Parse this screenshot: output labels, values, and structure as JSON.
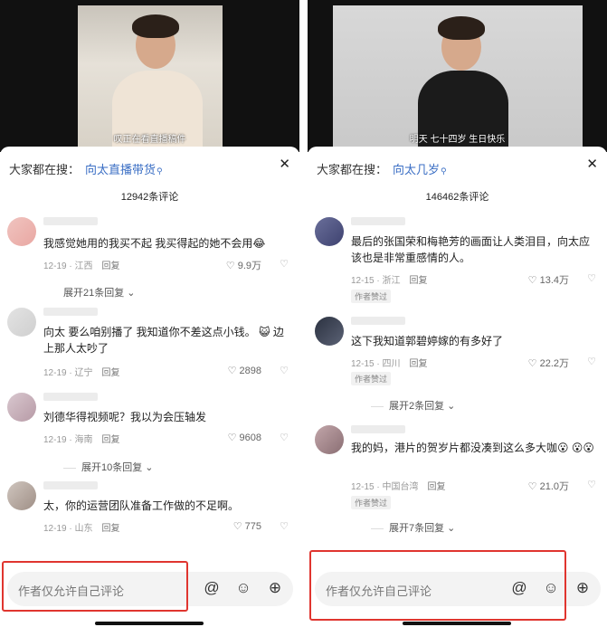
{
  "left": {
    "caption": "叹正在看直播稿件",
    "search_prefix": "大家都在搜：",
    "search_keyword": "向太直播带货",
    "comment_count": "12942条评论",
    "comments": [
      {
        "text": "我感觉她用的我买不起 我买得起的她不会用😂",
        "date": "12-19",
        "location": "江西",
        "reply": "回复",
        "likes": "9.9万",
        "expand": "展开21条回复"
      },
      {
        "text": "向太 要么咱别播了 我知道你不差这点小钱。 😺 边上那人太吵了",
        "date": "12-19",
        "location": "辽宁",
        "reply": "回复",
        "likes": "2898",
        "expand": ""
      },
      {
        "text": "刘德华得视频呢？我以为会压轴发",
        "date": "12-19",
        "location": "海南",
        "reply": "回复",
        "likes": "9608",
        "expand": "展开10条回复"
      },
      {
        "text": "太，你的运营团队准备工作做的不足啊。",
        "date": "12-19",
        "location": "山东",
        "reply": "回复",
        "likes": "775",
        "expand": ""
      }
    ],
    "input_placeholder": "作者仅允许自己评论"
  },
  "right": {
    "caption": "明天 七十四岁 生日快乐",
    "search_prefix": "大家都在搜：",
    "search_keyword": "向太几岁",
    "comment_count": "146462条评论",
    "comments": [
      {
        "text": "最后的张国荣和梅艳芳的画面让人类泪目，向太应该也是非常重感情的人。",
        "date": "12-15",
        "location": "浙江",
        "reply": "回复",
        "likes": "13.4万",
        "badge": "作者赞过",
        "expand": ""
      },
      {
        "text": "这下我知道郭碧婷嫁的有多好了",
        "date": "12-15",
        "location": "四川",
        "reply": "回复",
        "likes": "22.2万",
        "badge": "作者赞过",
        "expand": "展开2条回复"
      },
      {
        "text": "我的妈，港片的贺岁片都没凑到这么多大咖😮 😮😮",
        "date": "12-15",
        "location": "中国台湾",
        "reply": "回复",
        "likes": "21.0万",
        "badge": "作者赞过",
        "expand": "展开7条回复"
      }
    ],
    "input_placeholder": "作者仅允许自己评论"
  },
  "icons": {
    "at": "at-icon",
    "emoji": "emoji-icon",
    "plus": "plus-icon",
    "heart": "heart-icon",
    "dislike": "dislike-heart-icon",
    "close": "close-icon",
    "search": "search-icon"
  },
  "colors": {
    "keyword": "#3a6ec4",
    "highlight_box": "#e0352f",
    "input_bg": "#f3f3f3"
  }
}
